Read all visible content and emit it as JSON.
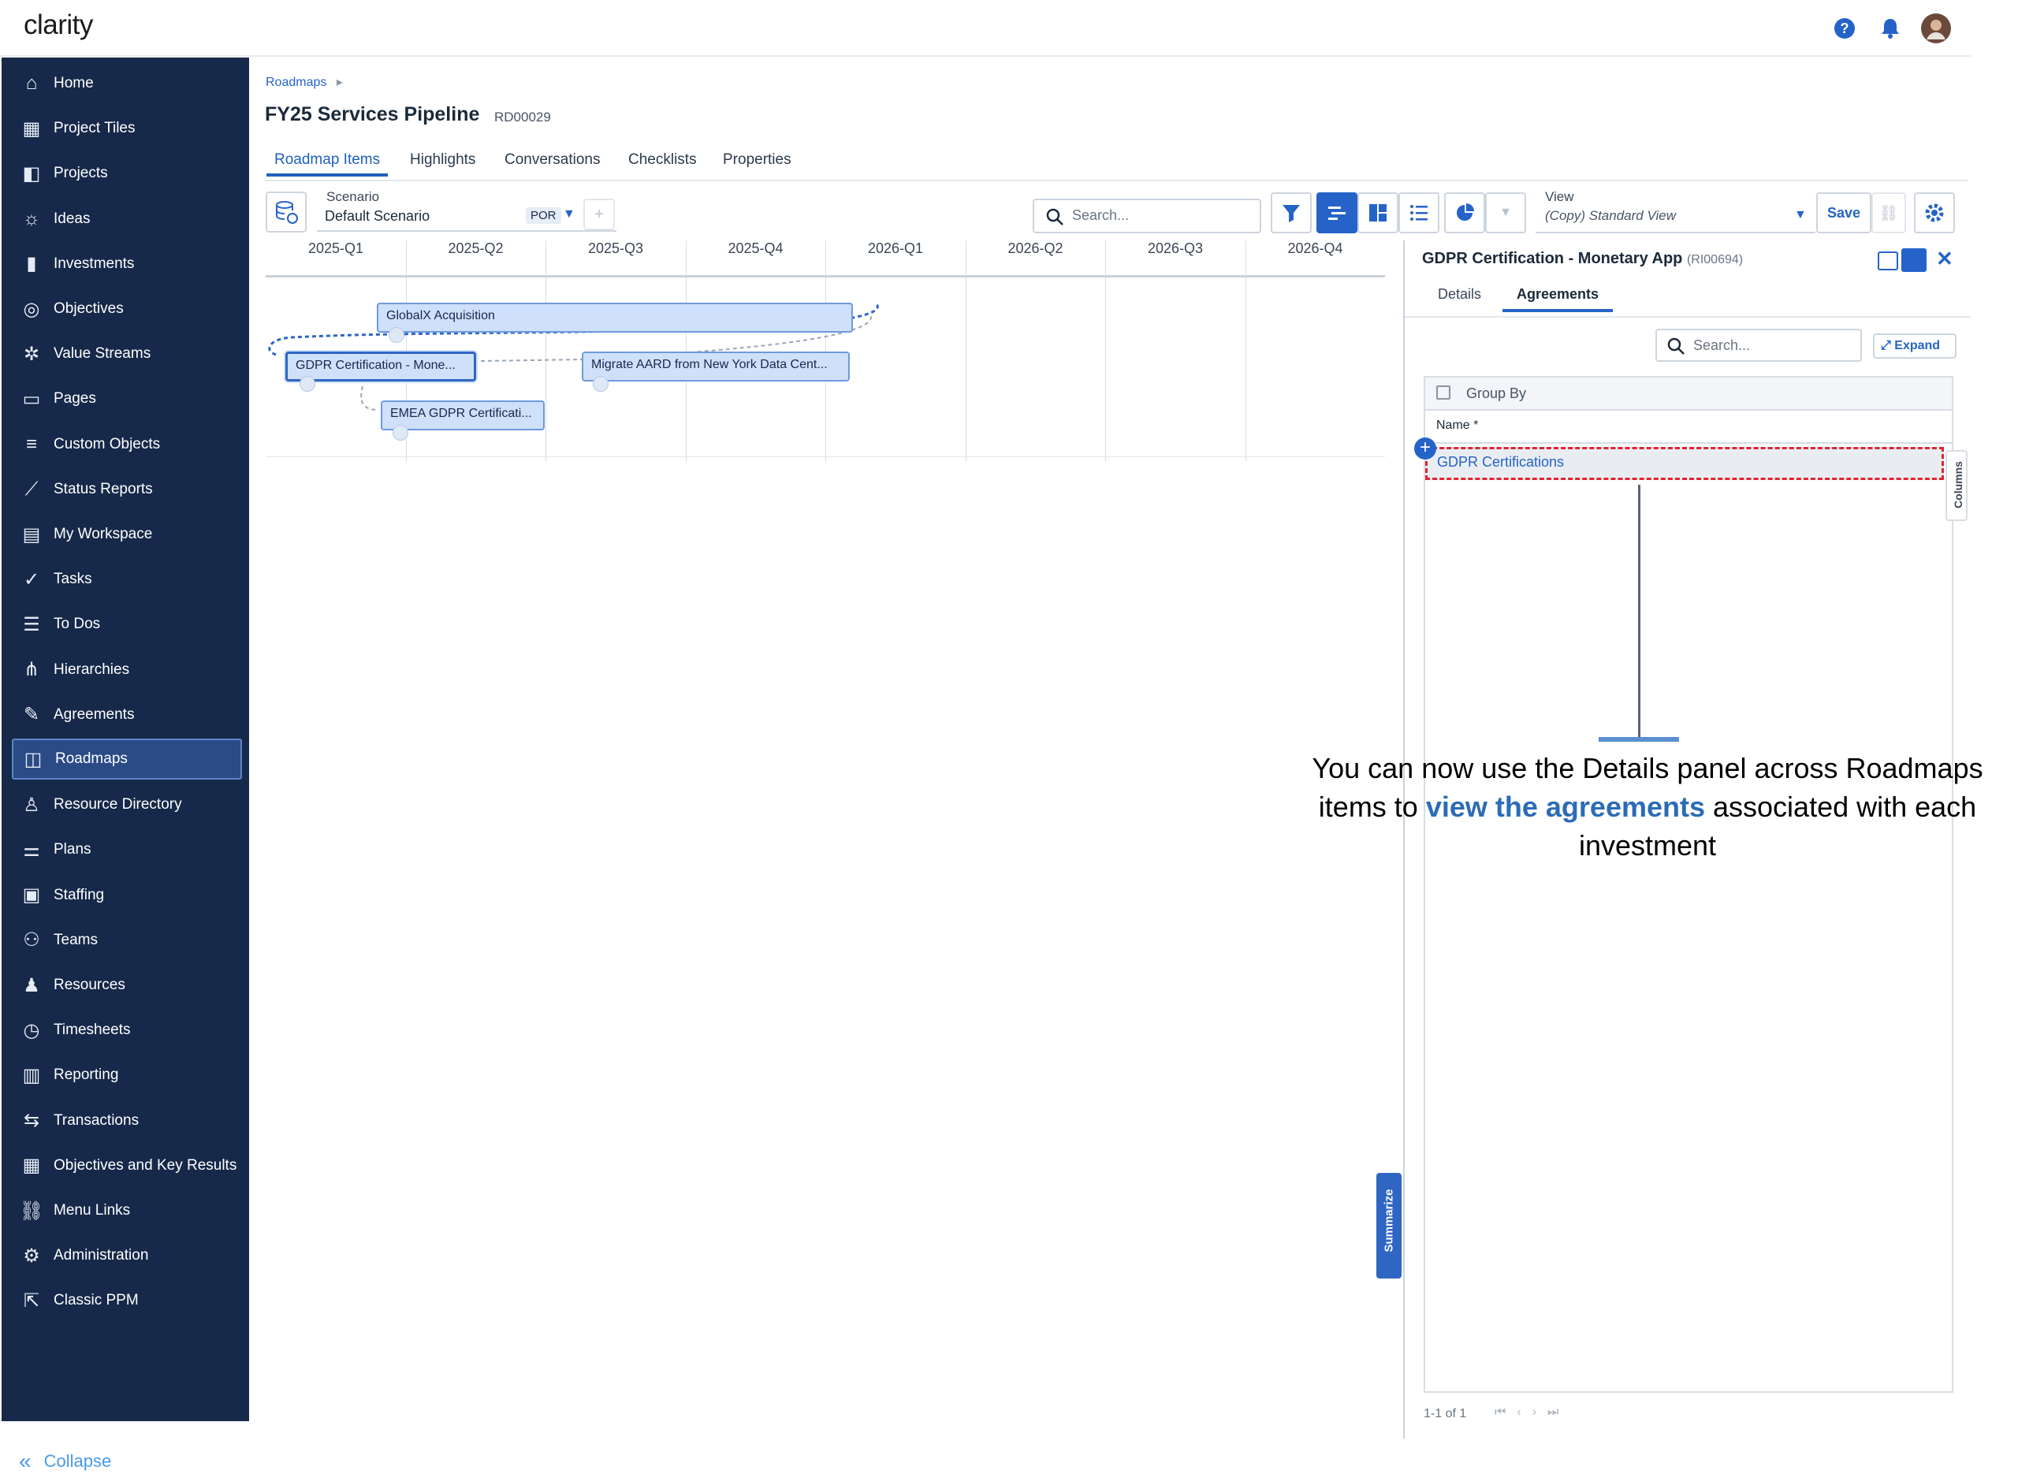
{
  "app": {
    "logo": "clarity"
  },
  "sidebar": {
    "items": [
      {
        "label": "Home",
        "icon": "home-icon"
      },
      {
        "label": "Project Tiles",
        "icon": "tiles-icon"
      },
      {
        "label": "Projects",
        "icon": "projects-icon"
      },
      {
        "label": "Ideas",
        "icon": "lightbulb-icon"
      },
      {
        "label": "Investments",
        "icon": "bar-chart-icon"
      },
      {
        "label": "Objectives",
        "icon": "target-icon"
      },
      {
        "label": "Value Streams",
        "icon": "value-streams-icon"
      },
      {
        "label": "Pages",
        "icon": "monitor-icon"
      },
      {
        "label": "Custom Objects",
        "icon": "database-icon"
      },
      {
        "label": "Status Reports",
        "icon": "trend-line-icon"
      },
      {
        "label": "My Workspace",
        "icon": "clipboard-icon"
      },
      {
        "label": "Tasks",
        "icon": "check-icon"
      },
      {
        "label": "To Dos",
        "icon": "checklist-icon"
      },
      {
        "label": "Hierarchies",
        "icon": "hierarchy-icon"
      },
      {
        "label": "Agreements",
        "icon": "agreement-icon"
      },
      {
        "label": "Roadmaps",
        "icon": "map-icon"
      },
      {
        "label": "Resource Directory",
        "icon": "resource-directory-icon"
      },
      {
        "label": "Plans",
        "icon": "plans-icon"
      },
      {
        "label": "Staffing",
        "icon": "staffing-icon"
      },
      {
        "label": "Teams",
        "icon": "teams-icon"
      },
      {
        "label": "Resources",
        "icon": "resources-icon"
      },
      {
        "label": "Timesheets",
        "icon": "clock-icon"
      },
      {
        "label": "Reporting",
        "icon": "report-icon"
      },
      {
        "label": "Transactions",
        "icon": "transactions-icon"
      },
      {
        "label": "Objectives and Key Results",
        "icon": "okr-icon"
      },
      {
        "label": "Menu Links",
        "icon": "link-icon"
      },
      {
        "label": "Administration",
        "icon": "admin-icon"
      },
      {
        "label": "Classic PPM",
        "icon": "external-icon"
      }
    ],
    "active": "Roadmaps",
    "collapse_label": "Collapse"
  },
  "breadcrumb": {
    "root": "Roadmaps"
  },
  "page": {
    "title": "FY25 Services Pipeline",
    "id": "RD00029"
  },
  "tabs": [
    "Roadmap Items",
    "Highlights",
    "Conversations",
    "Checklists",
    "Properties"
  ],
  "toolbar": {
    "scenario_label": "Scenario",
    "scenario_value": "Default Scenario",
    "scenario_badge": "POR",
    "search_placeholder": "Search...",
    "view_label": "View",
    "view_value": "(Copy) Standard View",
    "save_label": "Save"
  },
  "timeline": {
    "quarters": [
      "2025-Q1",
      "2025-Q2",
      "2025-Q3",
      "2025-Q4",
      "2026-Q1",
      "2026-Q2",
      "2026-Q3",
      "2026-Q4"
    ],
    "items": [
      "GlobalX Acquisition",
      "GDPR Certification - Mone...",
      "Migrate AARD from New York Data Cent...",
      "EMEA GDPR Certificati..."
    ]
  },
  "summarize_label": "Summarize",
  "panel": {
    "title": "GDPR Certification - Monetary App",
    "id": "(RI00694)",
    "tabs": [
      "Details",
      "Agreements"
    ],
    "search_placeholder": "Search...",
    "expand_label": "Expand",
    "group_by_label": "Group By",
    "name_col": "Name",
    "columns_label": "Columns",
    "row": "GDPR Certifications",
    "pagination": "1-1 of 1"
  },
  "callout": {
    "pre": "You can now use the Details panel across Roadmaps items to ",
    "highlight": "view the agreements",
    "post": " associated with each investment"
  }
}
